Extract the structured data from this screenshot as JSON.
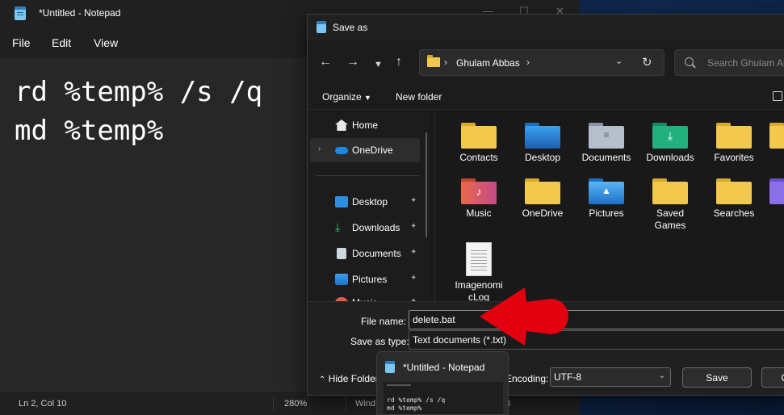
{
  "notepad": {
    "title": "*Untitled - Notepad",
    "menu": [
      "File",
      "Edit",
      "View"
    ],
    "lines": [
      "rd %temp% /s /q",
      "md %temp%"
    ],
    "status": {
      "position": "Ln 2, Col 10",
      "zoom": "280%",
      "line_ending_partial": "Wind",
      "encoding_partial": "8"
    }
  },
  "dialog": {
    "title": "Save as",
    "address": {
      "path": "Ghulam Abbas"
    },
    "search_placeholder": "Search Ghulam Abbas",
    "commands": {
      "organize": "Organize",
      "new_folder": "New folder"
    },
    "nav_pane": [
      {
        "label": "Home",
        "icon": "home-icon",
        "pinned": false,
        "selected": false
      },
      {
        "label": "OneDrive",
        "icon": "cloud-icon",
        "pinned": false,
        "selected": true,
        "expandable": true
      },
      {
        "label": "Desktop",
        "icon": "desktop-icon",
        "pinned": true
      },
      {
        "label": "Downloads",
        "icon": "download-icon",
        "pinned": true
      },
      {
        "label": "Documents",
        "icon": "document-icon",
        "pinned": true
      },
      {
        "label": "Pictures",
        "icon": "picture-icon",
        "pinned": true
      },
      {
        "label": "Music",
        "icon": "music-icon",
        "pinned": true
      }
    ],
    "files": [
      {
        "label": "Contacts",
        "kind": "folder"
      },
      {
        "label": "Desktop",
        "kind": "folder-desktop"
      },
      {
        "label": "Documents",
        "kind": "folder-documents"
      },
      {
        "label": "Downloads",
        "kind": "folder-downloads"
      },
      {
        "label": "Favorites",
        "kind": "folder"
      },
      {
        "label": "Music",
        "kind": "folder-music"
      },
      {
        "label": "OneDrive",
        "kind": "folder"
      },
      {
        "label": "Pictures",
        "kind": "folder-pictures"
      },
      {
        "label": "Saved Games",
        "kind": "folder"
      },
      {
        "label": "Searches",
        "kind": "folder"
      },
      {
        "label": "ImagenomicLog",
        "kind": "file"
      }
    ],
    "file_name_label": "File name:",
    "file_name_value": "delete.bat",
    "save_as_type_label": "Save as type:",
    "save_as_type_value": "Text documents (*.txt)",
    "hide_folders_label": "Hide Folders",
    "encoding_label": "Encoding:",
    "encoding_value": "UTF-8",
    "save_button": "Save",
    "cancel_button": "Cancel"
  },
  "taskbar_thumbnail": {
    "title": "*Untitled - Notepad",
    "preview_lines": [
      "rd %temp% /s /q",
      "md %temp%"
    ]
  },
  "colors": {
    "accent_red": "#e3000f",
    "folder_yellow": "#f2c94c"
  }
}
